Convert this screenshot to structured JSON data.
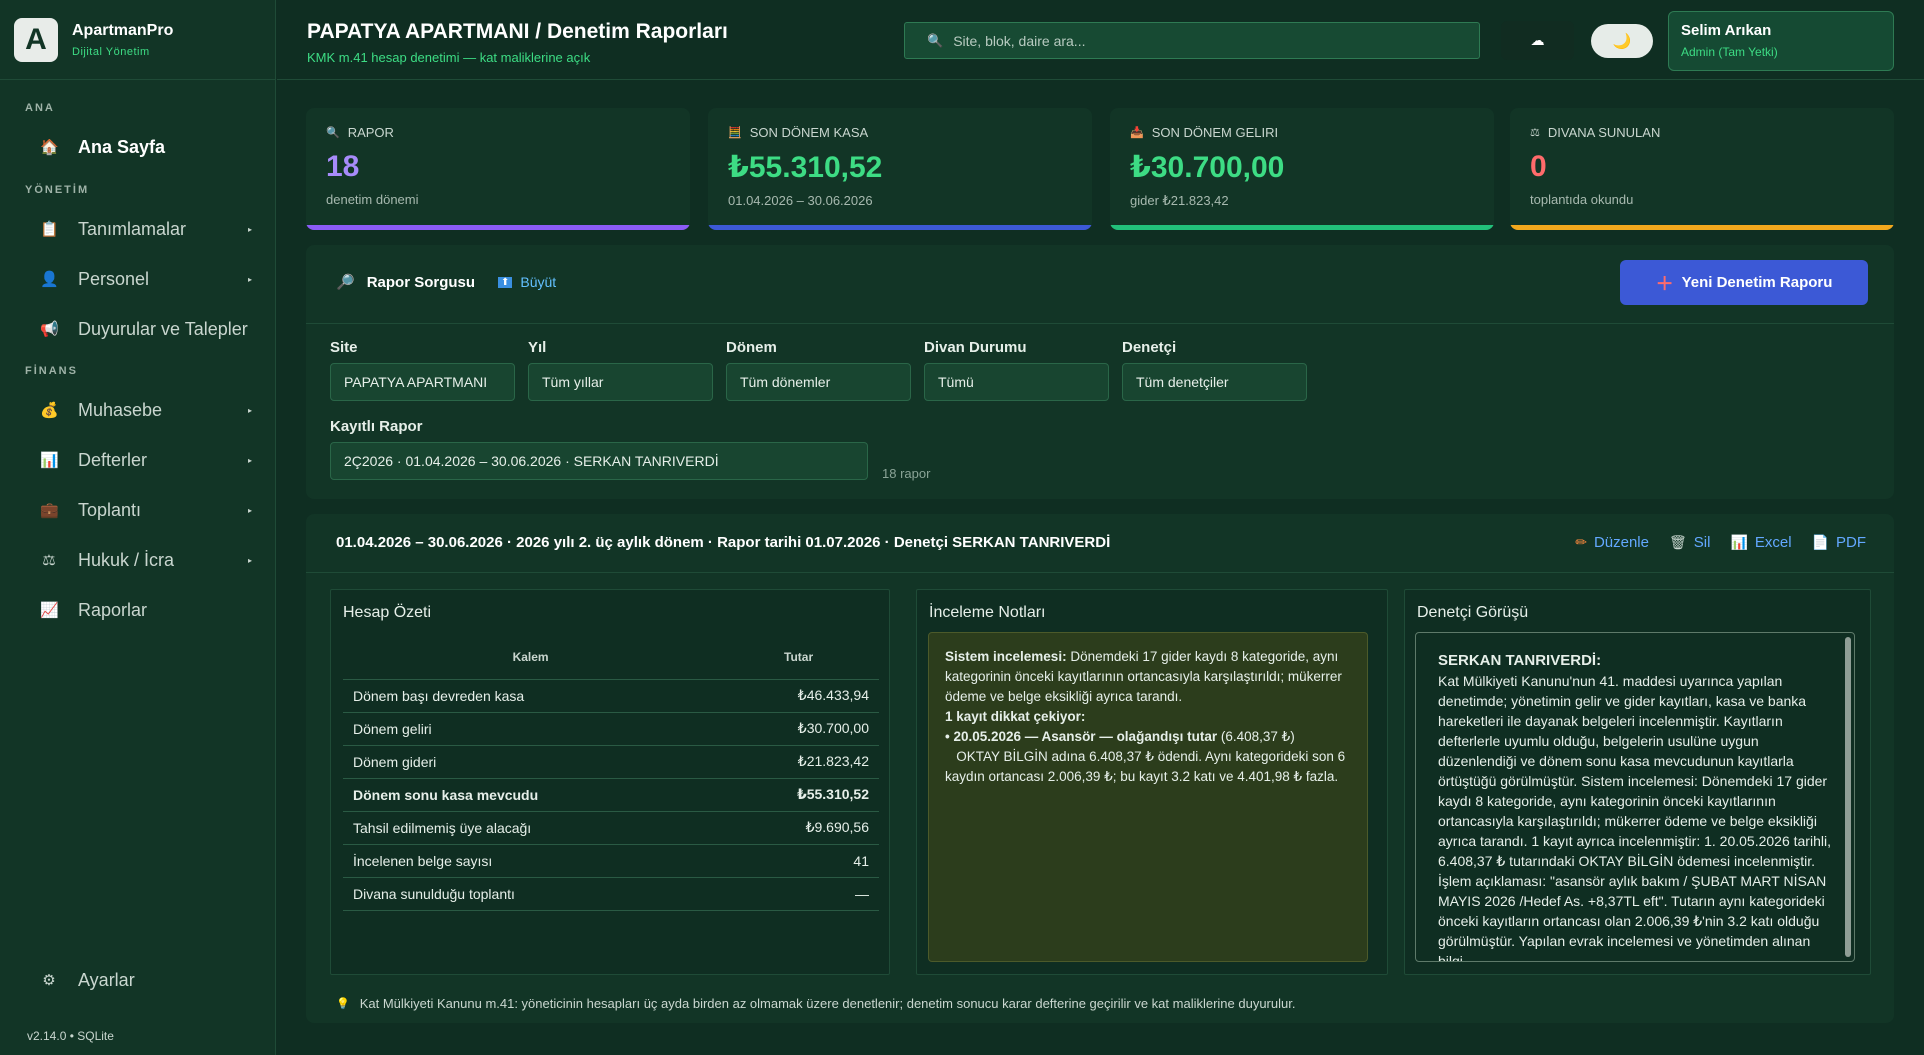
{
  "brand": {
    "logo_letter": "A",
    "name": "ApartmanPro",
    "subtitle": "Dijital Yönetim"
  },
  "sidebar": {
    "sections": [
      "ANA",
      "YÖNETİM",
      "FİNANS"
    ],
    "items": [
      {
        "label": "Ana Sayfa",
        "icon": "home-icon",
        "glyph": "🏠",
        "active": true,
        "has_submenu": false
      },
      {
        "label": "Tanımlamalar",
        "icon": "clipboard-icon",
        "glyph": "📋",
        "active": false,
        "has_submenu": true
      },
      {
        "label": "Personel",
        "icon": "person-icon",
        "glyph": "👤",
        "active": false,
        "has_submenu": true
      },
      {
        "label": "Duyurular ve Talepler",
        "icon": "megaphone-icon",
        "glyph": "📢",
        "active": false,
        "has_submenu": false
      },
      {
        "label": "Muhasebe",
        "icon": "money-bag-icon",
        "glyph": "💰",
        "active": false,
        "has_submenu": true
      },
      {
        "label": "Defterler",
        "icon": "bar-chart-icon",
        "glyph": "📊",
        "active": false,
        "has_submenu": true
      },
      {
        "label": "Toplantı",
        "icon": "briefcase-icon",
        "glyph": "💼",
        "active": false,
        "has_submenu": true
      },
      {
        "label": "Hukuk / İcra",
        "icon": "scales-icon",
        "glyph": "⚖",
        "active": false,
        "has_submenu": true
      },
      {
        "label": "Raporlar",
        "icon": "chart-up-icon",
        "glyph": "📈",
        "active": false,
        "has_submenu": false
      }
    ],
    "settings_label": "Ayarlar",
    "version": "v2.14.0  •  SQLite",
    "chevron": "▸"
  },
  "header": {
    "title": "PAPATYA APARTMANI  /  Denetim Raporları",
    "subtitle": "KMK m.41 hesap denetimi — kat maliklerine açık",
    "search_placeholder": "Site, blok, daire ara...",
    "user_name": "Selim Arıkan",
    "user_role": "Admin (Tam Yetki)"
  },
  "stats": [
    {
      "label": "RAPOR",
      "value": "18",
      "note": "denetim dönemi",
      "icon": "magnifier-icon",
      "glyph": "🔍",
      "value_color": "#a78bfa",
      "bar_color": "#8b5cf6"
    },
    {
      "label": "SON DÖNEM KASA",
      "value": "₺55.310,52",
      "note": "01.04.2026 – 30.06.2026",
      "icon": "abacus-icon",
      "glyph": "🧮",
      "value_color": "#3ddc84",
      "bar_color": "#3c59d6"
    },
    {
      "label": "SON DÖNEM GELIRI",
      "value": "₺30.700,00",
      "note": "gider ₺21.823,42",
      "icon": "inbox-icon",
      "glyph": "📥",
      "value_color": "#3ddc84",
      "bar_color": "#22c07a"
    },
    {
      "label": "DIVANA SUNULAN",
      "value": "0",
      "note": "toplantıda okundu",
      "icon": "scales-icon",
      "glyph": "⚖",
      "value_color": "#ff6b6b",
      "bar_color": "#f2a81d"
    }
  ],
  "query": {
    "title": "Rapor Sorgusu",
    "expand_label": "Büyüt",
    "new_button": "Yeni Denetim Raporu",
    "fields": {
      "site": {
        "label": "Site",
        "value": "PAPATYA APARTMANI"
      },
      "year": {
        "label": "Yıl",
        "value": "Tüm yıllar"
      },
      "period": {
        "label": "Dönem",
        "value": "Tüm dönemler"
      },
      "divan": {
        "label": "Divan Durumu",
        "value": "Tümü"
      },
      "auditor": {
        "label": "Denetçi",
        "value": "Tüm denetçiler"
      },
      "saved": {
        "label": "Kayıtlı Rapor",
        "value": "2Ç2026  ·  01.04.2026 – 30.06.2026  ·  SERKAN TANRIVERDİ"
      }
    },
    "count_note": "18 rapor"
  },
  "report": {
    "heading": "01.04.2026 – 30.06.2026  ·  2026 yılı 2. üç aylık dönem  ·  Rapor tarihi 01.07.2026  ·  Denetçi SERKAN TANRIVERDİ",
    "actions": {
      "edit": "Düzenle",
      "delete": "Sil",
      "excel": "Excel",
      "pdf": "PDF"
    },
    "summary": {
      "title": "Hesap Özeti",
      "col_item": "Kalem",
      "col_amount": "Tutar",
      "rows": [
        {
          "item": "Dönem başı devreden kasa",
          "amount": "₺46.433,94",
          "bold": false
        },
        {
          "item": "Dönem geliri",
          "amount": "₺30.700,00",
          "bold": false
        },
        {
          "item": "Dönem gideri",
          "amount": "₺21.823,42",
          "bold": false
        },
        {
          "item": "Dönem sonu kasa mevcudu",
          "amount": "₺55.310,52",
          "bold": true
        },
        {
          "item": "Tahsil edilmemiş üye alacağı",
          "amount": "₺9.690,56",
          "bold": false
        },
        {
          "item": "İncelenen belge sayısı",
          "amount": "41",
          "bold": false
        },
        {
          "item": "Divana sunulduğu toplantı",
          "amount": "—",
          "bold": false
        }
      ]
    },
    "notes": {
      "title": "İnceleme Notları",
      "intro_bold": "Sistem incelemesi:",
      "intro": " Dönemdeki 17 gider kaydı 8 kategoride, aynı kategorinin önceki kayıtlarının ortancasıyla karşılaştırıldı; mükerrer ödeme ve belge eksikliği ayrıca tarandı.",
      "flag_line": "1 kayıt dikkat çekiyor:",
      "item_bold": "• 20.05.2026 — Asansör — olağandışı tutar",
      "item_amount": " (6.408,37 ₺)",
      "item_detail": "   OKTAY BİLGİN adına 6.408,37 ₺ ödendi. Aynı kategorideki son 6 kaydın ortancası 2.006,39 ₺; bu kayıt 3.2 katı ve 4.401,98 ₺ fazla."
    },
    "opinion": {
      "title": "Denetçi Görüşü",
      "name": "SERKAN TANRIVERDİ:",
      "text": "Kat Mülkiyeti Kanunu'nun 41. maddesi uyarınca yapılan denetimde; yönetimin gelir ve gider kayıtları, kasa ve banka hareketleri ile dayanak belgeleri incelenmiştir. Kayıtların defterlerle uyumlu olduğu, belgelerin usulüne uygun düzenlendiği ve dönem sonu kasa mevcudunun kayıtlarla örtüştüğü görülmüştür. Sistem incelemesi: Dönemdeki 17 gider kaydı 8 kategoride, aynı kategorinin önceki kayıtlarının ortancasıyla karşılaştırıldı; mükerrer ödeme ve belge eksikliği ayrıca tarandı. 1 kayıt ayrıca incelenmiştir: 1. 20.05.2026 tarihli, 6.408,37 ₺ tutarındaki OKTAY BİLGİN ödemesi incelenmiştir. İşlem açıklaması: \"asansör aylık bakım / ŞUBAT MART NİSAN MAYIS 2026 /Hedef As. +8,37TL eft\". Tutarın aynı kategorideki önceki kayıtların ortancası olan 2.006,39 ₺'nin 3.2 katı olduğu görülmüştür. Yapılan evrak incelemesi ve yönetimden alınan bilgi"
    },
    "footnote": "Kat Mülkiyeti Kanunu m.41: yöneticinin hesapları üç ayda birden az olmamak üzere denetlenir; denetim sonucu karar defterine geçirilir ve kat maliklerine duyurulur."
  }
}
